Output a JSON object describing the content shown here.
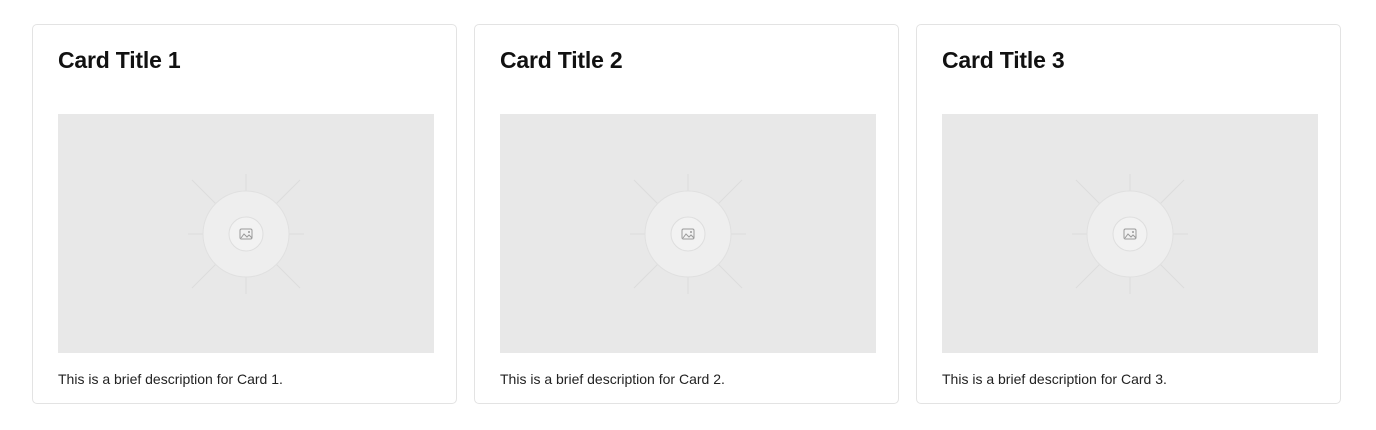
{
  "cards": [
    {
      "title": "Card Title 1",
      "image_icon": "image-placeholder-icon",
      "description": "This is a brief description for Card 1."
    },
    {
      "title": "Card Title 2",
      "image_icon": "image-placeholder-icon",
      "description": "This is a brief description for Card 2."
    },
    {
      "title": "Card Title 3",
      "image_icon": "image-placeholder-icon",
      "description": "This is a brief description for Card 3."
    }
  ],
  "colors": {
    "placeholder_bg": "#e8e8e8",
    "card_border": "#e3e3e3",
    "text": "#111111"
  }
}
